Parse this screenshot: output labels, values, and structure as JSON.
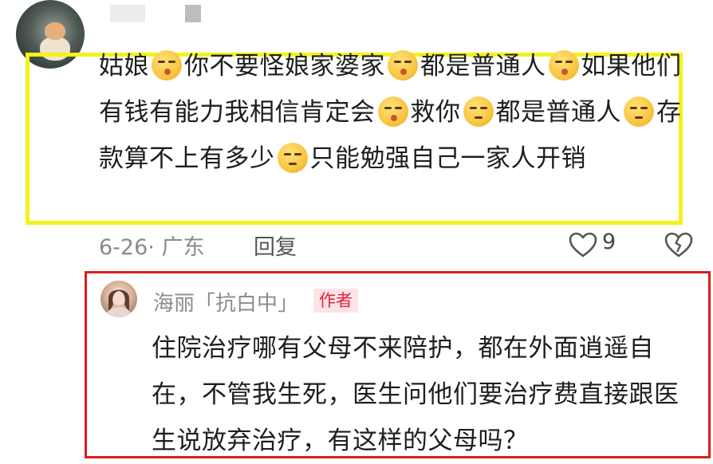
{
  "comment": {
    "segments": [
      {
        "text": "姑娘"
      },
      {
        "emoji": "kiss-face-emoji"
      },
      {
        "text": "你不要怪娘家婆家"
      },
      {
        "emoji": "kiss-face-emoji"
      },
      {
        "text": "都是普通人"
      },
      {
        "emoji": "kiss-face-emoji"
      },
      {
        "text": "如果他们有钱有能力我相信肯定会"
      },
      {
        "emoji": "kiss-face-emoji"
      },
      {
        "text": "救你"
      },
      {
        "emoji": "unamused-face-emoji"
      },
      {
        "text": "都是普通人"
      },
      {
        "emoji": "unamused-face-emoji"
      },
      {
        "text": "存款算不上有多少"
      },
      {
        "emoji": "unamused-face-emoji"
      },
      {
        "text": "只能勉强自己一家人开销"
      }
    ],
    "date_location": "6-26· 广东",
    "reply_label": "回复",
    "like_count": "9"
  },
  "reply": {
    "author_name": "海丽「抗白中」",
    "author_badge": "作者",
    "text": "住院治疗哪有父母不来陪护，都在外面逍遥自在，不管我生死，医生问他们要治疗费直接跟医生说放弃治疗，有这样的父母吗？"
  },
  "colors": {
    "highlight_yellow": "#f3f31a",
    "highlight_red": "#d91f1f",
    "author_badge_bg": "#fde3e6",
    "author_badge_text": "#e0243d"
  }
}
